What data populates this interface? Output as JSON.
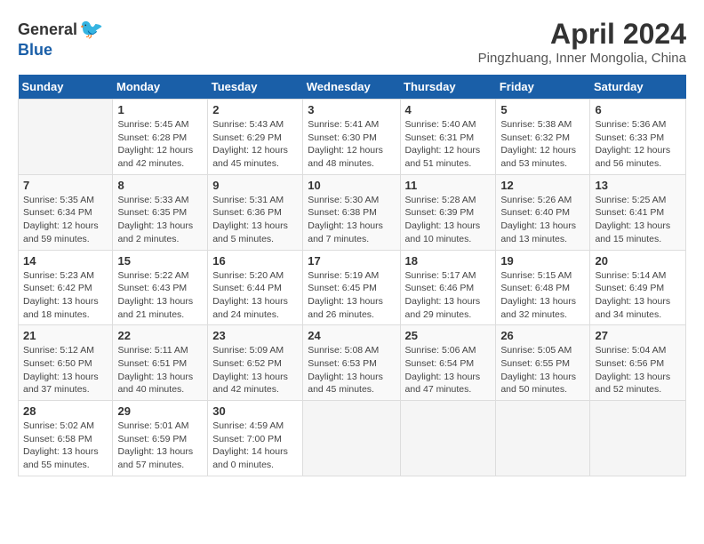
{
  "header": {
    "logo_general": "General",
    "logo_blue": "Blue",
    "title": "April 2024",
    "location": "Pingzhuang, Inner Mongolia, China"
  },
  "weekdays": [
    "Sunday",
    "Monday",
    "Tuesday",
    "Wednesday",
    "Thursday",
    "Friday",
    "Saturday"
  ],
  "weeks": [
    [
      {
        "day": "",
        "sunrise": "",
        "sunset": "",
        "daylight": ""
      },
      {
        "day": "1",
        "sunrise": "Sunrise: 5:45 AM",
        "sunset": "Sunset: 6:28 PM",
        "daylight": "Daylight: 12 hours and 42 minutes."
      },
      {
        "day": "2",
        "sunrise": "Sunrise: 5:43 AM",
        "sunset": "Sunset: 6:29 PM",
        "daylight": "Daylight: 12 hours and 45 minutes."
      },
      {
        "day": "3",
        "sunrise": "Sunrise: 5:41 AM",
        "sunset": "Sunset: 6:30 PM",
        "daylight": "Daylight: 12 hours and 48 minutes."
      },
      {
        "day": "4",
        "sunrise": "Sunrise: 5:40 AM",
        "sunset": "Sunset: 6:31 PM",
        "daylight": "Daylight: 12 hours and 51 minutes."
      },
      {
        "day": "5",
        "sunrise": "Sunrise: 5:38 AM",
        "sunset": "Sunset: 6:32 PM",
        "daylight": "Daylight: 12 hours and 53 minutes."
      },
      {
        "day": "6",
        "sunrise": "Sunrise: 5:36 AM",
        "sunset": "Sunset: 6:33 PM",
        "daylight": "Daylight: 12 hours and 56 minutes."
      }
    ],
    [
      {
        "day": "7",
        "sunrise": "Sunrise: 5:35 AM",
        "sunset": "Sunset: 6:34 PM",
        "daylight": "Daylight: 12 hours and 59 minutes."
      },
      {
        "day": "8",
        "sunrise": "Sunrise: 5:33 AM",
        "sunset": "Sunset: 6:35 PM",
        "daylight": "Daylight: 13 hours and 2 minutes."
      },
      {
        "day": "9",
        "sunrise": "Sunrise: 5:31 AM",
        "sunset": "Sunset: 6:36 PM",
        "daylight": "Daylight: 13 hours and 5 minutes."
      },
      {
        "day": "10",
        "sunrise": "Sunrise: 5:30 AM",
        "sunset": "Sunset: 6:38 PM",
        "daylight": "Daylight: 13 hours and 7 minutes."
      },
      {
        "day": "11",
        "sunrise": "Sunrise: 5:28 AM",
        "sunset": "Sunset: 6:39 PM",
        "daylight": "Daylight: 13 hours and 10 minutes."
      },
      {
        "day": "12",
        "sunrise": "Sunrise: 5:26 AM",
        "sunset": "Sunset: 6:40 PM",
        "daylight": "Daylight: 13 hours and 13 minutes."
      },
      {
        "day": "13",
        "sunrise": "Sunrise: 5:25 AM",
        "sunset": "Sunset: 6:41 PM",
        "daylight": "Daylight: 13 hours and 15 minutes."
      }
    ],
    [
      {
        "day": "14",
        "sunrise": "Sunrise: 5:23 AM",
        "sunset": "Sunset: 6:42 PM",
        "daylight": "Daylight: 13 hours and 18 minutes."
      },
      {
        "day": "15",
        "sunrise": "Sunrise: 5:22 AM",
        "sunset": "Sunset: 6:43 PM",
        "daylight": "Daylight: 13 hours and 21 minutes."
      },
      {
        "day": "16",
        "sunrise": "Sunrise: 5:20 AM",
        "sunset": "Sunset: 6:44 PM",
        "daylight": "Daylight: 13 hours and 24 minutes."
      },
      {
        "day": "17",
        "sunrise": "Sunrise: 5:19 AM",
        "sunset": "Sunset: 6:45 PM",
        "daylight": "Daylight: 13 hours and 26 minutes."
      },
      {
        "day": "18",
        "sunrise": "Sunrise: 5:17 AM",
        "sunset": "Sunset: 6:46 PM",
        "daylight": "Daylight: 13 hours and 29 minutes."
      },
      {
        "day": "19",
        "sunrise": "Sunrise: 5:15 AM",
        "sunset": "Sunset: 6:48 PM",
        "daylight": "Daylight: 13 hours and 32 minutes."
      },
      {
        "day": "20",
        "sunrise": "Sunrise: 5:14 AM",
        "sunset": "Sunset: 6:49 PM",
        "daylight": "Daylight: 13 hours and 34 minutes."
      }
    ],
    [
      {
        "day": "21",
        "sunrise": "Sunrise: 5:12 AM",
        "sunset": "Sunset: 6:50 PM",
        "daylight": "Daylight: 13 hours and 37 minutes."
      },
      {
        "day": "22",
        "sunrise": "Sunrise: 5:11 AM",
        "sunset": "Sunset: 6:51 PM",
        "daylight": "Daylight: 13 hours and 40 minutes."
      },
      {
        "day": "23",
        "sunrise": "Sunrise: 5:09 AM",
        "sunset": "Sunset: 6:52 PM",
        "daylight": "Daylight: 13 hours and 42 minutes."
      },
      {
        "day": "24",
        "sunrise": "Sunrise: 5:08 AM",
        "sunset": "Sunset: 6:53 PM",
        "daylight": "Daylight: 13 hours and 45 minutes."
      },
      {
        "day": "25",
        "sunrise": "Sunrise: 5:06 AM",
        "sunset": "Sunset: 6:54 PM",
        "daylight": "Daylight: 13 hours and 47 minutes."
      },
      {
        "day": "26",
        "sunrise": "Sunrise: 5:05 AM",
        "sunset": "Sunset: 6:55 PM",
        "daylight": "Daylight: 13 hours and 50 minutes."
      },
      {
        "day": "27",
        "sunrise": "Sunrise: 5:04 AM",
        "sunset": "Sunset: 6:56 PM",
        "daylight": "Daylight: 13 hours and 52 minutes."
      }
    ],
    [
      {
        "day": "28",
        "sunrise": "Sunrise: 5:02 AM",
        "sunset": "Sunset: 6:58 PM",
        "daylight": "Daylight: 13 hours and 55 minutes."
      },
      {
        "day": "29",
        "sunrise": "Sunrise: 5:01 AM",
        "sunset": "Sunset: 6:59 PM",
        "daylight": "Daylight: 13 hours and 57 minutes."
      },
      {
        "day": "30",
        "sunrise": "Sunrise: 4:59 AM",
        "sunset": "Sunset: 7:00 PM",
        "daylight": "Daylight: 14 hours and 0 minutes."
      },
      {
        "day": "",
        "sunrise": "",
        "sunset": "",
        "daylight": ""
      },
      {
        "day": "",
        "sunrise": "",
        "sunset": "",
        "daylight": ""
      },
      {
        "day": "",
        "sunrise": "",
        "sunset": "",
        "daylight": ""
      },
      {
        "day": "",
        "sunrise": "",
        "sunset": "",
        "daylight": ""
      }
    ]
  ]
}
